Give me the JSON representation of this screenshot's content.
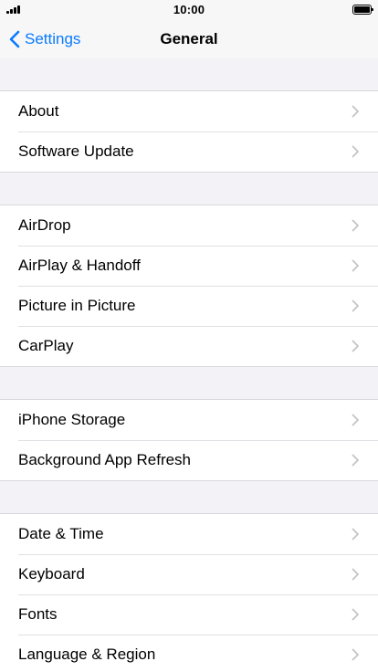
{
  "status_bar": {
    "time": "10:00",
    "signal_icon": "cellular-signal-icon",
    "battery_icon": "battery-icon"
  },
  "nav": {
    "back_label": "Settings",
    "title": "General",
    "back_icon": "chevron-left-icon"
  },
  "colors": {
    "accent": "#0a7aff",
    "background": "#f2f2f7",
    "row": "#ffffff",
    "separator": "#d8d8dc",
    "chevron": "#c4c4c7"
  },
  "groups": [
    {
      "items": [
        {
          "label": "About"
        },
        {
          "label": "Software Update"
        }
      ]
    },
    {
      "items": [
        {
          "label": "AirDrop"
        },
        {
          "label": "AirPlay & Handoff"
        },
        {
          "label": "Picture in Picture"
        },
        {
          "label": "CarPlay"
        }
      ]
    },
    {
      "items": [
        {
          "label": "iPhone Storage"
        },
        {
          "label": "Background App Refresh"
        }
      ]
    },
    {
      "items": [
        {
          "label": "Date & Time"
        },
        {
          "label": "Keyboard"
        },
        {
          "label": "Fonts"
        },
        {
          "label": "Language & Region"
        }
      ]
    }
  ]
}
